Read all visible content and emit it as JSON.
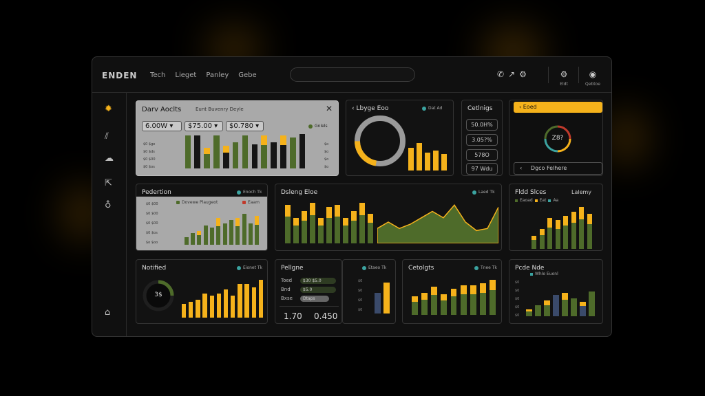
{
  "app": {
    "title": "ENDEN"
  },
  "nav": [
    "Tech",
    "Lieget",
    "Panley",
    "Gebe"
  ],
  "search": {
    "placeholder": ""
  },
  "top_actions": [
    {
      "icon": "gear-icon",
      "label": "Eldt"
    },
    {
      "icon": "profile-icon",
      "label": "Qebtoe"
    }
  ],
  "sidebar_icons": [
    "sun-icon",
    "analytics-icon",
    "cloud-icon",
    "export-icon",
    "bulb-icon",
    "home-icon"
  ],
  "colors": {
    "accent": "#f5b21b",
    "olive": "#4e6b2a",
    "black_bar": "#151515",
    "teal": "#3ba3a0"
  },
  "panels": {
    "daily": {
      "title": "Darv Aoclts",
      "subtitle": "Eunt Buvenry Deyle",
      "close_icon": "close-icon",
      "chips": [
        "6.00W",
        "$75.00",
        "$0.780"
      ],
      "legend": "Gnlels",
      "yticks_left": [
        "$0 $ge",
        "$0 $ds",
        "$0 $00",
        "$0 $os"
      ],
      "yticks_right": [
        "$o",
        "$o",
        "$o",
        "$o"
      ]
    },
    "usage": {
      "back_icon": "chevron-left-icon",
      "title": "Lbyge Eoo",
      "legend": "Dat Ad"
    },
    "config": {
      "title": "Cetlnigs",
      "stats": [
        "50.0H%",
        "3.05?%",
        "578O",
        "97 Wdu"
      ]
    },
    "finance": {
      "button": "Eoed",
      "gauge_value": "Z8?",
      "footer": "Dgco Felhere",
      "back_icon": "chevron-left-icon"
    },
    "prediction": {
      "title": "Pedertion",
      "legend": "Enoch Tk",
      "sub_legend_a": "Dovewe Plaugeot",
      "sub_legend_b": "Eaam",
      "yticks": [
        "$0 $00",
        "$0 $00",
        "$0 $00",
        "$0 $os",
        "$o $oo"
      ]
    },
    "delivery": {
      "title": "Dsleng Eloe",
      "legend": "Laed Tk"
    },
    "field": {
      "title": "Fldd Slces",
      "subtitle": "Lalemy",
      "legend_a": "Eaoad",
      "legend_b": "Eat",
      "legend_c": "Aa"
    },
    "notified": {
      "title": "Notified",
      "legend": "Eionet Tk",
      "donut_label": "3$"
    },
    "profile": {
      "title": "Pellgne",
      "rows": [
        {
          "key": "Toed",
          "val": "$30 $5.0"
        },
        {
          "key": "Bnd",
          "val": "$5.0"
        },
        {
          "key": "Bxse",
          "val": "Dtaps"
        }
      ],
      "values": [
        "1.70",
        "0.450"
      ]
    },
    "mini": {
      "legend": "Etaeo Tk",
      "yticks": [
        "$0",
        "$0",
        "$0",
        "$0"
      ]
    },
    "categories": {
      "title": "Cetolgts",
      "legend": "Tnee Tk"
    },
    "pcde": {
      "title": "Pcde Nde",
      "legend": "Whle Euonl",
      "yticks": [
        "$0",
        "$0",
        "$0",
        "$0",
        "$0"
      ]
    }
  },
  "chart_data": [
    {
      "type": "bar",
      "title": "Darv Aoclts",
      "series": [
        {
          "values": [
            0.95,
            0.95,
            0.6,
            0.95,
            0.65,
            0.75,
            0.95,
            0.7,
            0.95,
            0.75,
            0.95,
            0.9,
            1.0
          ]
        }
      ]
    },
    {
      "type": "pie",
      "title": "Lbyge Eoo",
      "values": [
        78,
        22
      ]
    },
    {
      "type": "bar",
      "title": "Lbyge Eoo",
      "values": [
        0.75,
        0.9,
        0.6,
        0.65,
        0.55
      ]
    },
    {
      "type": "bar",
      "title": "Pedertion",
      "values": [
        0.2,
        0.3,
        0.35,
        0.5,
        0.45,
        0.7,
        0.55,
        0.65,
        0.7,
        0.8,
        0.55,
        0.75
      ]
    },
    {
      "type": "bar",
      "title": "Dsleng Eloe",
      "values": [
        0.9,
        0.6,
        0.75,
        0.95,
        0.6,
        0.85,
        0.9,
        0.6,
        0.75,
        0.95,
        0.7
      ]
    },
    {
      "type": "area",
      "title": "Dsleng Eloe",
      "values": [
        0.35,
        0.5,
        0.35,
        0.45,
        0.6,
        0.75,
        0.6,
        0.9,
        0.5,
        0.3,
        0.35,
        0.85
      ]
    },
    {
      "type": "bar",
      "title": "Fldd Slces",
      "values": [
        0.3,
        0.45,
        0.7,
        0.65,
        0.75,
        0.85,
        0.95,
        0.8
      ]
    },
    {
      "type": "bar",
      "title": "Notified",
      "values": [
        0.35,
        0.4,
        0.45,
        0.6,
        0.55,
        0.6,
        0.7,
        0.55,
        0.85,
        0.85,
        0.75,
        0.95
      ]
    },
    {
      "type": "bar",
      "title": "Pellgne",
      "values": [
        0.6,
        0.9
      ]
    },
    {
      "type": "bar",
      "title": "Cetolgts",
      "values": [
        0.5,
        0.6,
        0.75,
        0.55,
        0.7,
        0.8,
        0.8,
        0.85,
        0.95
      ]
    },
    {
      "type": "bar",
      "title": "Pcde Nde",
      "values": [
        0.2,
        0.3,
        0.45,
        0.6,
        0.65,
        0.5,
        0.4,
        0.7
      ]
    }
  ]
}
